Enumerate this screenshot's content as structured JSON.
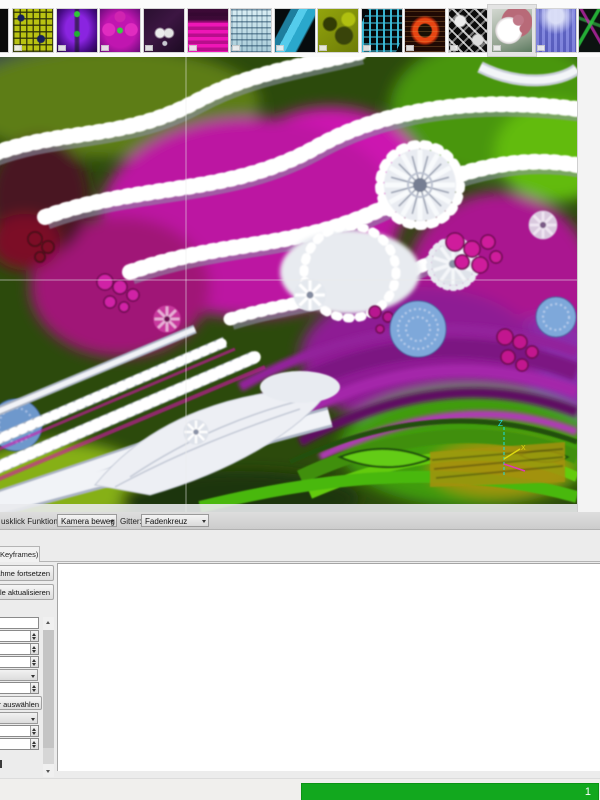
{
  "filmstrip": {
    "thumbnails": [
      {
        "name": "thumb-0-partial",
        "style": "t0",
        "selected": false
      },
      {
        "name": "thumb-1-tile-grid",
        "style": "t1",
        "selected": false
      },
      {
        "name": "thumb-2-purple-fractal",
        "style": "t2",
        "selected": false
      },
      {
        "name": "thumb-3-kaleidoscope",
        "style": "t3",
        "selected": false
      },
      {
        "name": "thumb-4-dark-mask",
        "style": "t4",
        "selected": false
      },
      {
        "name": "thumb-5-magenta-stripes",
        "style": "t5",
        "selected": false
      },
      {
        "name": "thumb-6-blue-etching",
        "style": "t6",
        "selected": false
      },
      {
        "name": "thumb-7-cyan-blocks",
        "style": "t7",
        "selected": false
      },
      {
        "name": "thumb-8-olive-gears",
        "style": "t8",
        "selected": false
      },
      {
        "name": "thumb-9-cyan-lattice",
        "style": "t9",
        "selected": false
      },
      {
        "name": "thumb-10-red-ring",
        "style": "t10",
        "selected": false
      },
      {
        "name": "thumb-11-bw-fractal",
        "style": "t11",
        "selected": false
      },
      {
        "name": "thumb-12-sphere",
        "style": "t12",
        "selected": true
      },
      {
        "name": "thumb-13-spike-field",
        "style": "t13",
        "selected": false
      },
      {
        "name": "thumb-14-wireframe",
        "style": "t14",
        "selected": false
      }
    ]
  },
  "render": {
    "axis_labels": {
      "z": "Z",
      "x": "X"
    }
  },
  "toolbar": {
    "mouse_function_label": "usklick Funktion:",
    "mouse_function_value": "Kamera beweg",
    "grid_label": "Gitter:",
    "grid_value": "Fadenkreuz"
  },
  "tabs": {
    "active_label": "Keyframes)"
  },
  "actions": {
    "continue_recording_label": "ahme fortsetzen",
    "refresh_table_label": "lle aktualisieren"
  },
  "panel": {
    "rows": [
      {
        "type": "input"
      },
      {
        "type": "spin"
      },
      {
        "type": "spin"
      },
      {
        "type": "spin"
      },
      {
        "type": "select"
      },
      {
        "type": "spin"
      },
      {
        "type": "btnrow",
        "label": "r auswählen"
      },
      {
        "type": "select"
      },
      {
        "type": "spin"
      },
      {
        "type": "spin"
      }
    ]
  },
  "progress": {
    "value_label": "1",
    "bar_color": "#12a81e"
  },
  "colors": {
    "progress_green": "#12a81e",
    "render_magenta": "#c016a6",
    "render_green": "#4fb40e",
    "render_purple": "#8e1f94",
    "toolbar_bg": "#d6d6d6"
  }
}
